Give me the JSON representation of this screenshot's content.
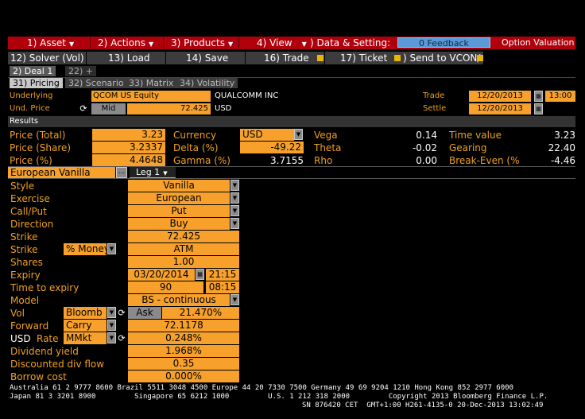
{
  "menu": {
    "asset": "1) Asset",
    "actions": "2) Actions",
    "products": "3) Products",
    "view": "4) View",
    "data_settings": ") Data & Setting:",
    "feedback": "0 Feedback",
    "title": "Option Valuation"
  },
  "toolbar": {
    "solver": "12) Solver (Vol)",
    "load": "13) Load",
    "save": "14) Save",
    "trade": "16) Trade",
    "ticket": "17) Ticket",
    "send": ") Send to VCON/"
  },
  "deal_tabs": {
    "deal1": "2) Deal 1",
    "add": "22) +"
  },
  "sub_tabs": {
    "pricing": "31) Pricing",
    "scenario": "32) Scenario",
    "matrix": "33) Matrix",
    "volatility": "34) Volatility"
  },
  "header": {
    "underlying_label": "Underlying",
    "underlying_value": "QCOM US Equity",
    "underlying_name": "QUALCOMM INC",
    "und_price_label": "Und. Price",
    "mid_label": "Mid",
    "und_price_value": "72.425",
    "currency": "USD",
    "trade_label": "Trade",
    "trade_date": "12/20/2013",
    "trade_time": "13:00",
    "settle_label": "Settle",
    "settle_date": "12/20/2013"
  },
  "results": {
    "title": "Results",
    "price_total_label": "Price (Total)",
    "price_total": "3.23",
    "price_share_label": "Price (Share)",
    "price_share": "3.2337",
    "price_pct_label": "Price (%)",
    "price_pct": "4.4648",
    "currency_label": "Currency",
    "currency_value": "USD",
    "delta_label": "Delta (%)",
    "delta": "-49.22",
    "gamma_label": "Gamma (%)",
    "gamma": "3.7155",
    "vega_label": "Vega",
    "vega": "0.14",
    "theta_label": "Theta",
    "theta": "-0.02",
    "rho_label": "Rho",
    "rho": "0.00",
    "timevalue_label": "Time value",
    "timevalue": "3.23",
    "gearing_label": "Gearing",
    "gearing": "22.40",
    "breakeven_label": "Break-Even (%",
    "breakeven": "-4.46"
  },
  "deal": {
    "product": "European Vanilla",
    "more": "...",
    "leg": "Leg 1",
    "style_label": "Style",
    "style": "Vanilla",
    "exercise_label": "Exercise",
    "exercise": "European",
    "callput_label": "Call/Put",
    "callput": "Put",
    "direction_label": "Direction",
    "direction": "Buy",
    "strike_label": "Strike",
    "strike": "72.425",
    "strike2_label": "Strike",
    "strike_mode": "% Money",
    "strike_type": "ATM",
    "shares_label": "Shares",
    "shares": "1.00",
    "expiry_label": "Expiry",
    "expiry_date": "03/20/2014",
    "expiry_time": "21:15",
    "tte_label": "Time to expiry",
    "tte_days": "90",
    "tte_time": "08:15",
    "model_label": "Model",
    "model": "BS - continuous",
    "vol_label": "Vol",
    "vol_source": "Bloomb",
    "vol_side": "Ask",
    "vol": "21.470%",
    "forward_label": "Forward",
    "forward_mode": "Carry",
    "forward": "72.1178",
    "rate_ccy": "USD",
    "rate_label": "Rate",
    "rate_source": "MMkt",
    "rate": "0.248%",
    "divyield_label": "Dividend yield",
    "divyield": "1.968%",
    "divflow_label": "Discounted div flow",
    "divflow": "0.35",
    "borrow_label": "Borrow cost",
    "borrow": "0.000%"
  },
  "footer": {
    "line1": "Australia 61 2 9777 8600 Brazil 5511 3048 4500 Europe 44 20 7330 7500 Germany 49 69 9204 1210 Hong Kong 852 2977 6000",
    "line2": "Japan 81 3 3201 8900         Singapore 65 6212 1000         U.S. 1 212 318 2000         Copyright 2013 Bloomberg Finance L.P.",
    "line3": "SN 876420 CET  GMT+1:00 H261-4135-0 20-Dec-2013 13:02:49"
  },
  "colors": {
    "accent": "#f7a12c",
    "menu": "#b0000c",
    "label": "#f0a020"
  }
}
